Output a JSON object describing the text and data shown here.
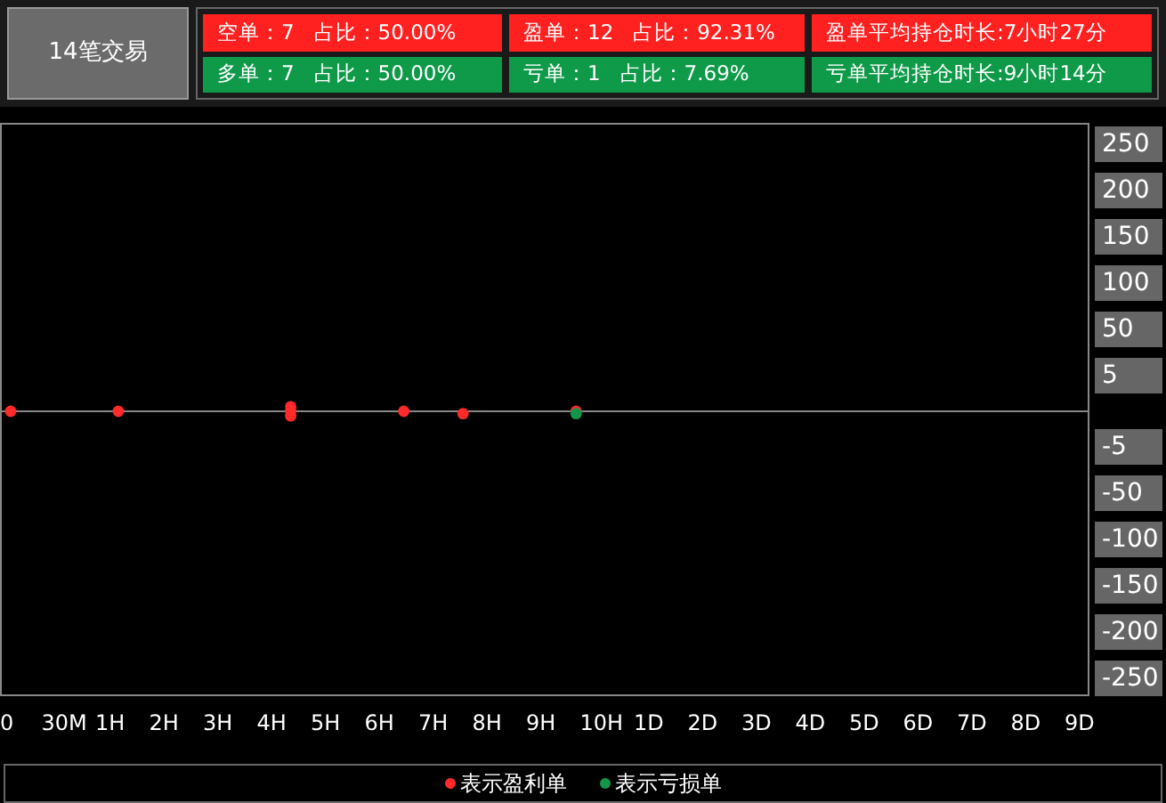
{
  "summary": {
    "title": "14笔交易",
    "stats": [
      {
        "text": "空单：7   占比：50.00%",
        "color": "#ff2020"
      },
      {
        "text": "盈单：12   占比：92.31%",
        "color": "#ff2020"
      },
      {
        "text": "盈单平均持仓时长:7小时27分",
        "color": "#ff2020"
      },
      {
        "text": "多单：7   占比：50.00%",
        "color": "#0f9a4a"
      },
      {
        "text": "亏单：1   占比：7.69%",
        "color": "#0f9a4a"
      },
      {
        "text": "亏单平均持仓时长:9小时14分",
        "color": "#0f9a4a"
      }
    ]
  },
  "chart": {
    "y_axis_labels": [
      "250",
      "200",
      "150",
      "100",
      "50",
      "5",
      "-5",
      "-50",
      "-100",
      "-150",
      "-200",
      "-250"
    ],
    "x_axis_labels": [
      "0",
      "30M",
      "1H",
      "2H",
      "3H",
      "4H",
      "5H",
      "6H",
      "7H",
      "8H",
      "9H",
      "10H",
      "1D",
      "2D",
      "3D",
      "4D",
      "5D",
      "6D",
      "7D",
      "8D",
      "9D"
    ],
    "legend": [
      {
        "label": "表示盈利单",
        "color": "#ff2a2a"
      },
      {
        "label": "表示亏损单",
        "color": "#12964a"
      }
    ]
  }
}
